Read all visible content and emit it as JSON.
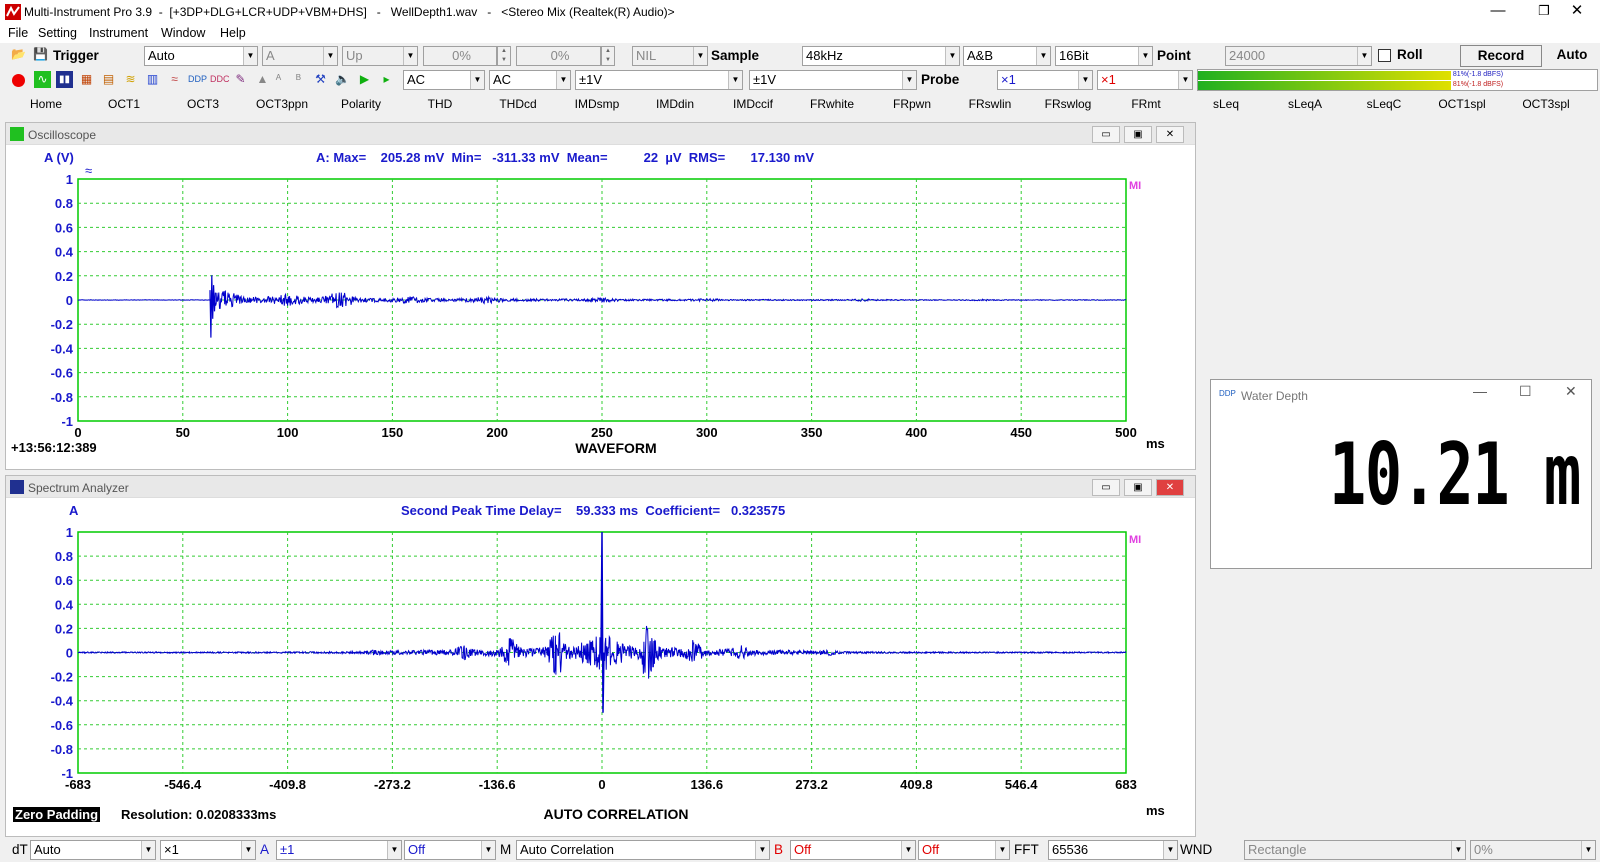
{
  "window": {
    "title": "Multi-Instrument Pro 3.9  -  [+3DP+DLG+LCR+UDP+VBM+DHS]   -   WellDepth1.wav   -   <Stereo Mix (Realtek(R) Audio)>",
    "minimize": "—",
    "restore": "❐",
    "close": "✕"
  },
  "menu": [
    {
      "label": "File"
    },
    {
      "label": "Setting"
    },
    {
      "label": "Instrument"
    },
    {
      "label": "Window"
    },
    {
      "label": "Help"
    }
  ],
  "toolbar1": {
    "trigger_label": "Trigger",
    "trigger_mode": "Auto",
    "trigger_source": "A",
    "trigger_edge": "Up",
    "level1": "0%",
    "level2": "0%",
    "nil": "NIL",
    "sample_label": "Sample",
    "sample_rate": "48kHz",
    "channels": "A&B",
    "bits": "16Bit",
    "point_label": "Point",
    "points": "24000",
    "roll_label": "Roll",
    "record_label": "Record",
    "auto_label": "Auto"
  },
  "toolbar2": {
    "coupling_a": "AC",
    "coupling_b": "AC",
    "range_a": "±1V",
    "range_b": "±1V",
    "probe_label": "Probe",
    "probe_a": "×1",
    "probe_b": "×1",
    "meter_a": "81%(-1.8 dBFS)",
    "meter_b": "81%(-1.8 dBFS)",
    "meter_level": 0.81
  },
  "quick_tabs": [
    "Home",
    "OCT1",
    "OCT3",
    "OCT3ppn",
    "Polarity",
    "THD",
    "THDcd",
    "IMDsmp",
    "IMDdin",
    "IMDccif",
    "FRwhite",
    "FRpwn",
    "FRswlin",
    "FRswlog",
    "FRmt",
    "sLeq",
    "sLeqA",
    "sLeqC",
    "OCT1spl",
    "OCT3spl"
  ],
  "oscilloscope": {
    "title": "Oscilloscope",
    "y_unit": "A (V)",
    "meas": "A: Max=    205.28 mV  Min=   -311.33 mV  Mean=          22  µV  RMS=       17.130 mV",
    "timestamp": "+13:56:12:389",
    "x_title": "WAVEFORM",
    "x_unit": "ms",
    "logo": "MI"
  },
  "spectrum": {
    "title": "Spectrum Analyzer",
    "y_unit": "A",
    "meas": "Second Peak Time Delay=    59.333 ms  Coefficient=   0.323575",
    "zero_padding": "Zero Padding",
    "resolution": "Resolution: 0.0208333ms",
    "x_title": "AUTO CORRELATION",
    "x_unit": "ms",
    "logo": "MI"
  },
  "water_depth": {
    "title": "Water Depth",
    "value": "10.21 m"
  },
  "bottombar": {
    "dt_label": "dT",
    "dt": "Auto",
    "mult": "×1",
    "a_label": "A",
    "a_range": "±1",
    "a_off": "Off",
    "m_label": "M",
    "func": "Auto Correlation",
    "b_label": "B",
    "b_off": "Off",
    "off3": "Off",
    "fft_label": "FFT",
    "fft": "65536",
    "wnd_label": "WND",
    "wnd": "Rectangle",
    "pct": "0%"
  },
  "chart_data": [
    {
      "type": "line",
      "name": "oscilloscope",
      "title": "WAVEFORM",
      "xlabel": "ms",
      "ylabel": "A (V)",
      "xlim": [
        0,
        500
      ],
      "ylim": [
        -1,
        1
      ],
      "x_ticks": [
        0,
        50,
        100,
        150,
        200,
        250,
        300,
        350,
        400,
        450,
        500
      ],
      "y_ticks": [
        1,
        0.8,
        0.6,
        0.4,
        0.2,
        0,
        -0.2,
        -0.4,
        -0.6,
        -0.8,
        -1
      ],
      "grid": true,
      "series": [
        {
          "color": "#0000cc",
          "features": [
            {
              "x": 63,
              "max": 0.205,
              "min": -0.311
            },
            {
              "x": 70,
              "amp": 0.04
            },
            {
              "x": 100,
              "amp": 0.03
            },
            {
              "x": 125,
              "amp": 0.04
            },
            {
              "x": 150,
              "amp": 0.015
            },
            {
              "x": 200,
              "amp": 0.015
            },
            {
              "x": 250,
              "amp": 0.01
            },
            {
              "x": 300,
              "amp": 0.005
            },
            {
              "x": 370,
              "amp": 0.005
            },
            {
              "x": 430,
              "amp": 0.004
            },
            {
              "x": 500,
              "amp": 0.001
            }
          ]
        }
      ]
    },
    {
      "type": "line",
      "name": "autocorrelation",
      "title": "AUTO CORRELATION",
      "xlabel": "ms",
      "ylabel": "A",
      "xlim": [
        -683,
        683
      ],
      "ylim": [
        -1,
        1
      ],
      "x_ticks": [
        "-683",
        "-546.4",
        "-409.8",
        "-273.2",
        "-136.6",
        "0",
        "136.6",
        "273.2",
        "409.8",
        "546.4",
        "683"
      ],
      "y_ticks": [
        1,
        0.8,
        0.6,
        0.4,
        0.2,
        0,
        -0.2,
        -0.4,
        -0.6,
        -0.8,
        -1
      ],
      "grid": true,
      "series": [
        {
          "color": "#0000cc",
          "peak": {
            "x": 0,
            "y": 1.0,
            "min": -0.5
          },
          "features": [
            {
              "x": -59.3,
              "amp": 0.3
            },
            {
              "x": 59.3,
              "amp": 0.32
            },
            {
              "x": -120,
              "amp": 0.15
            },
            {
              "x": 120,
              "amp": 0.12
            },
            {
              "x": -180,
              "amp": 0.06
            },
            {
              "x": 180,
              "amp": 0.06
            },
            {
              "x": -300,
              "amp": 0.02
            },
            {
              "x": 300,
              "amp": 0.02
            }
          ]
        }
      ]
    }
  ]
}
